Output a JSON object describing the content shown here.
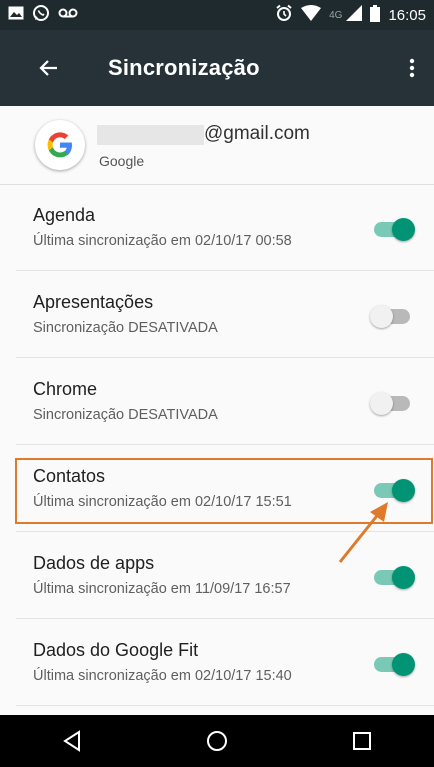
{
  "status_bar": {
    "network": "4G",
    "time": "16:05",
    "icons": [
      "image-icon",
      "whatsapp-icon",
      "voicemail-icon",
      "alarm-icon",
      "wifi-icon",
      "signal-icon",
      "battery-icon"
    ]
  },
  "app_bar": {
    "title": "Sincronização",
    "back_icon": "arrow-back-icon",
    "more_icon": "more-vert-icon",
    "background": "#263238"
  },
  "account": {
    "email": "@gmail.com",
    "type": "Google",
    "avatar_icon": "google-g-icon"
  },
  "sync_items": [
    {
      "name": "Agenda",
      "status": "Última sincronização em 02/10/17 00:58",
      "enabled": true
    },
    {
      "name": "Apresentações",
      "status": "Sincronização DESATIVADA",
      "enabled": false
    },
    {
      "name": "Chrome",
      "status": "Sincronização DESATIVADA",
      "enabled": false
    },
    {
      "name": "Contatos",
      "status": "Última sincronização em 02/10/17 15:51",
      "enabled": true,
      "highlighted": true
    },
    {
      "name": "Dados de apps",
      "status": "Última sincronização em 11/09/17 16:57",
      "enabled": true
    },
    {
      "name": "Dados do Google Fit",
      "status": "Última sincronização em 02/10/17 15:40",
      "enabled": true
    }
  ],
  "colors": {
    "toggle_on": "#009475",
    "toggle_on_track": "#79c9b6",
    "highlight": "#e07a2b"
  },
  "nav_bar": {
    "icons": [
      "back-triangle-icon",
      "home-circle-icon",
      "recents-square-icon"
    ]
  }
}
